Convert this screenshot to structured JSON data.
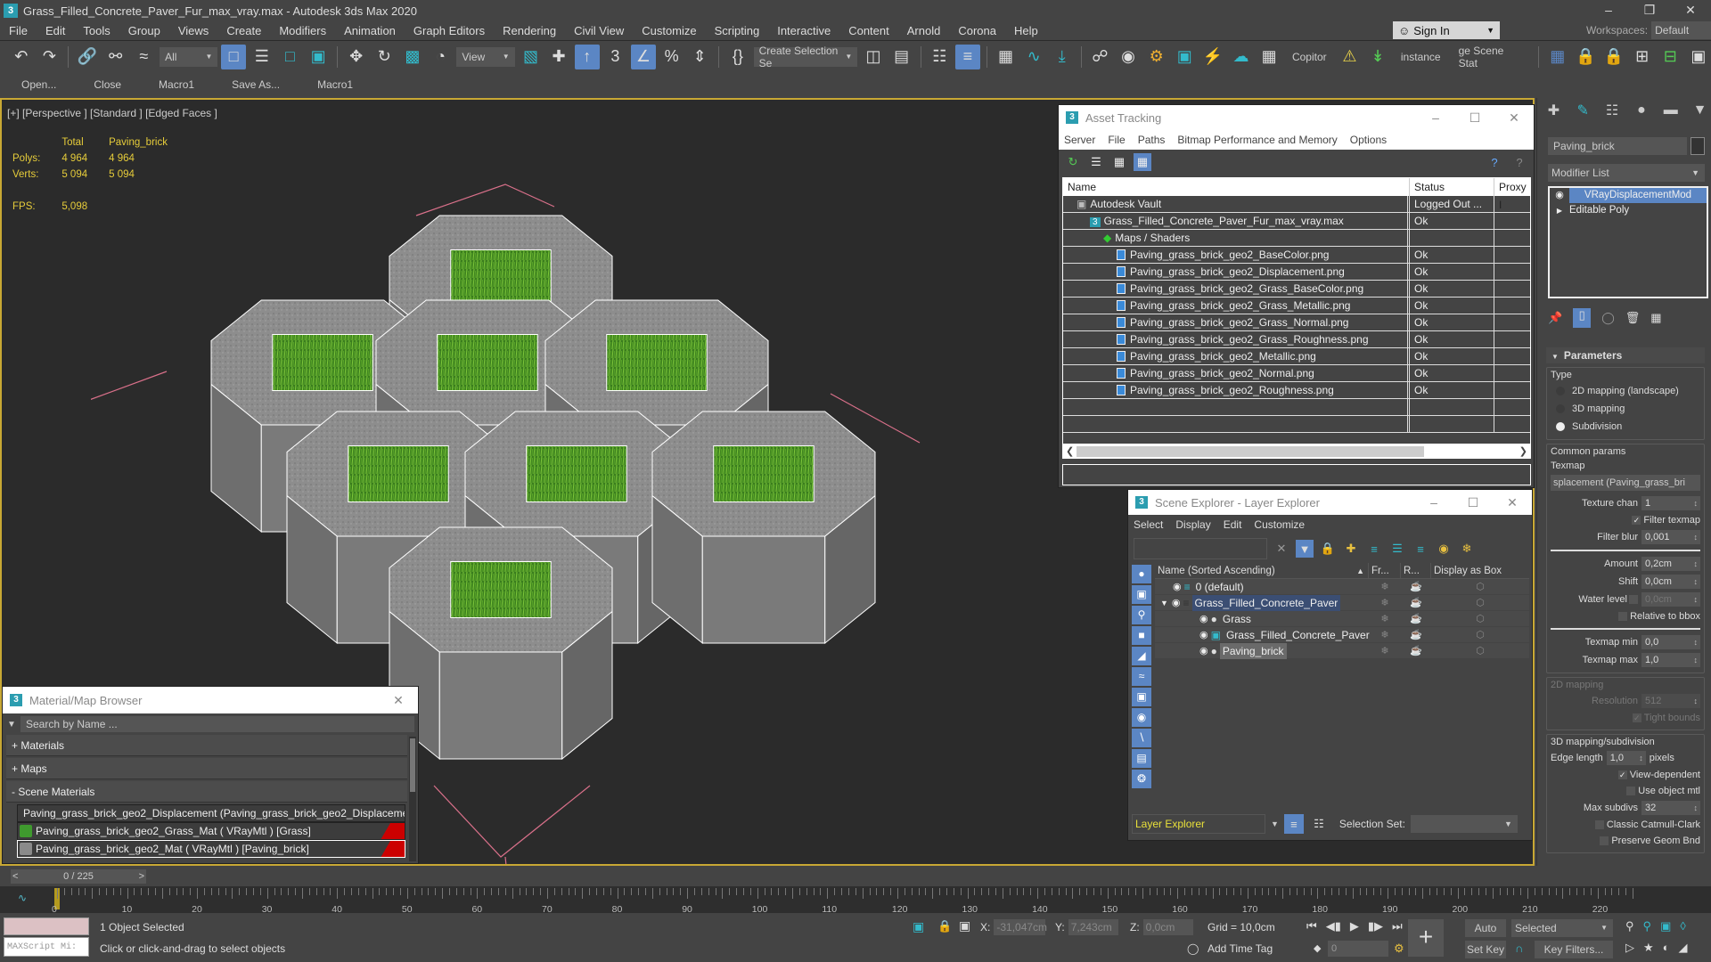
{
  "window": {
    "title": "Grass_Filled_Concrete_Paver_Fur_max_vray.max - Autodesk 3ds Max 2020",
    "app_icon": "3",
    "controls": [
      "minimize-icon",
      "restore-icon",
      "close-icon"
    ]
  },
  "menu": [
    "File",
    "Edit",
    "Tools",
    "Group",
    "Views",
    "Create",
    "Modifiers",
    "Animation",
    "Graph Editors",
    "Rendering",
    "Civil View",
    "Customize",
    "Scripting",
    "Interactive",
    "Content",
    "Arnold",
    "Corona",
    "Help"
  ],
  "account": {
    "sign_in": "Sign In",
    "workspaces_label": "Workspaces:",
    "workspace": "Default"
  },
  "main_toolbar": {
    "selection_filter": "All",
    "ref_coord": "View",
    "create_selection_set": "Create Selection Se",
    "text_buttons": [
      "Copitor",
      "instance",
      "ge Scene Stat"
    ]
  },
  "sub_toolbar": [
    "Open...",
    "Close",
    "Macro1",
    "Save As...",
    "Macro1"
  ],
  "viewport": {
    "label": "[+] [Perspective ] [Standard ] [Edged Faces ]",
    "stats": {
      "col_total": "Total",
      "col_object": "Paving_brick",
      "polys_label": "Polys:",
      "polys_total": "4 964",
      "polys_object": "4 964",
      "verts_label": "Verts:",
      "verts_total": "5 094",
      "verts_object": "5 094",
      "fps_label": "FPS:",
      "fps": "5,098"
    }
  },
  "asset_tracking": {
    "title": "Asset Tracking",
    "menu": [
      "Server",
      "File",
      "Paths",
      "Bitmap Performance and Memory",
      "Options"
    ],
    "columns": [
      "Name",
      "Status",
      "Proxy I"
    ],
    "rows": [
      {
        "name": "Autodesk Vault",
        "status": "Logged Out ...",
        "level": 1,
        "icon": "vault-icon"
      },
      {
        "name": "Grass_Filled_Concrete_Paver_Fur_max_vray.max",
        "status": "Ok",
        "level": 2,
        "icon": "max-file-icon"
      },
      {
        "name": "Maps / Shaders",
        "status": "",
        "level": 3,
        "icon": "maps-icon"
      },
      {
        "name": "Paving_grass_brick_geo2_BaseColor.png",
        "status": "Ok",
        "level": 4,
        "icon": "image-file-icon"
      },
      {
        "name": "Paving_grass_brick_geo2_Displacement.png",
        "status": "Ok",
        "level": 4,
        "icon": "image-file-icon"
      },
      {
        "name": "Paving_grass_brick_geo2_Grass_BaseColor.png",
        "status": "Ok",
        "level": 4,
        "icon": "image-file-icon"
      },
      {
        "name": "Paving_grass_brick_geo2_Grass_Metallic.png",
        "status": "Ok",
        "level": 4,
        "icon": "image-file-icon"
      },
      {
        "name": "Paving_grass_brick_geo2_Grass_Normal.png",
        "status": "Ok",
        "level": 4,
        "icon": "image-file-icon"
      },
      {
        "name": "Paving_grass_brick_geo2_Grass_Roughness.png",
        "status": "Ok",
        "level": 4,
        "icon": "image-file-icon"
      },
      {
        "name": "Paving_grass_brick_geo2_Metallic.png",
        "status": "Ok",
        "level": 4,
        "icon": "image-file-icon"
      },
      {
        "name": "Paving_grass_brick_geo2_Normal.png",
        "status": "Ok",
        "level": 4,
        "icon": "image-file-icon"
      },
      {
        "name": "Paving_grass_brick_geo2_Roughness.png",
        "status": "Ok",
        "level": 4,
        "icon": "image-file-icon"
      },
      {
        "name": "",
        "status": "",
        "level": 0,
        "icon": ""
      },
      {
        "name": "",
        "status": "",
        "level": 0,
        "icon": ""
      }
    ],
    "path_value": ""
  },
  "scene_explorer": {
    "title": "Scene Explorer - Layer Explorer",
    "menu": [
      "Select",
      "Display",
      "Edit",
      "Customize"
    ],
    "search_value": "",
    "columns": [
      "Name (Sorted Ascending)",
      "Fr...",
      "R...",
      "Display as Box"
    ],
    "rows": [
      {
        "name": "0 (default)",
        "level": 1,
        "type": "layer",
        "state": "normal"
      },
      {
        "name": "Grass_Filled_Concrete_Paver",
        "level": 1,
        "type": "layer",
        "state": "highlighted",
        "expanded": true
      },
      {
        "name": "Grass",
        "level": 2,
        "type": "object",
        "state": "normal"
      },
      {
        "name": "Grass_Filled_Concrete_Paver",
        "level": 2,
        "type": "group",
        "state": "normal"
      },
      {
        "name": "Paving_brick",
        "level": 2,
        "type": "object",
        "state": "selected"
      }
    ],
    "explorer_type": "Layer Explorer",
    "selection_set_label": "Selection Set:",
    "selection_set_value": ""
  },
  "material_browser": {
    "title": "Material/Map Browser",
    "search_placeholder": "Search by Name ...",
    "categories": [
      "+ Materials",
      "+ Maps",
      "- Scene Materials"
    ],
    "items": [
      {
        "label": "Paving_grass_brick_geo2_Displacement (Paving_grass_brick_geo2_Displaceme...",
        "swatch": "#111111",
        "flag": false,
        "selected": false
      },
      {
        "label": "Paving_grass_brick_geo2_Grass_Mat ( VRayMtl ) [Grass]",
        "swatch": "#3f9a2e",
        "flag": true,
        "selected": false
      },
      {
        "label": "Paving_grass_brick_geo2_Mat ( VRayMtl ) [Paving_brick]",
        "swatch": "#8a8a8a",
        "flag": true,
        "selected": true
      }
    ]
  },
  "command_panel": {
    "object_name": "Paving_brick",
    "modifier_list": "Modifier List",
    "stack": [
      {
        "label": "VRayDisplacementMod",
        "selected": true
      },
      {
        "label": "Editable Poly",
        "selected": false
      }
    ],
    "rollout_title": "Parameters",
    "type_group": "Type",
    "type_options": [
      {
        "label": "2D mapping (landscape)",
        "checked": false
      },
      {
        "label": "3D mapping",
        "checked": false
      },
      {
        "label": "Subdivision",
        "checked": true
      }
    ],
    "common_group": "Common params",
    "texmap_label": "Texmap",
    "texmap_value": "splacement (Paving_grass_bri",
    "texture_chan_label": "Texture chan",
    "texture_chan": "1",
    "filter_texmap_label": "Filter texmap",
    "filter_texmap": true,
    "filter_blur_label": "Filter blur",
    "filter_blur": "0,001",
    "amount_label": "Amount",
    "amount": "0,2cm",
    "shift_label": "Shift",
    "shift": "0,0cm",
    "water_level_label": "Water level",
    "water_level": "0,0cm",
    "relative_bbox_label": "Relative to bbox",
    "texmap_min_label": "Texmap min",
    "texmap_min": "0,0",
    "texmap_max_label": "Texmap max",
    "texmap_max": "1,0",
    "mapping2d_group": "2D mapping",
    "resolution_label": "Resolution",
    "resolution": "512",
    "tight_bounds_label": "Tight bounds",
    "mapping3d_group": "3D mapping/subdivision",
    "edge_length_label": "Edge length",
    "edge_length": "1,0",
    "edge_unit": "pixels",
    "view_dependent_label": "View-dependent",
    "use_object_mtl_label": "Use object mtl",
    "max_subdivs_label": "Max subdivs",
    "max_subdivs": "32",
    "catmull_label": "Classic Catmull-Clark",
    "preserve_geom_label": "Preserve Geom Bnd"
  },
  "timeline": {
    "frame_display": "0 / 225",
    "current_frame": 0,
    "total_frames": 225,
    "ticks": [
      "0",
      "10",
      "20",
      "30",
      "40",
      "50",
      "60",
      "70",
      "80",
      "90",
      "100",
      "110",
      "120",
      "130",
      "140",
      "150",
      "160",
      "170",
      "180",
      "190",
      "200",
      "210",
      "220"
    ]
  },
  "status_bar": {
    "selection": "1 Object Selected",
    "prompt": "Click or click-and-drag to select objects",
    "maxscript": "MAXScript Mi:",
    "x_label": "X:",
    "x": "-31,047cm",
    "y_label": "Y:",
    "y": "7,243cm",
    "z_label": "Z:",
    "z": "0,0cm",
    "grid": "Grid = 10,0cm",
    "add_time_tag": "Add Time Tag",
    "frame": "0",
    "auto_key": "Auto Key",
    "set_key": "Set Key",
    "key_mode": "Selected",
    "key_filters": "Key Filters..."
  }
}
